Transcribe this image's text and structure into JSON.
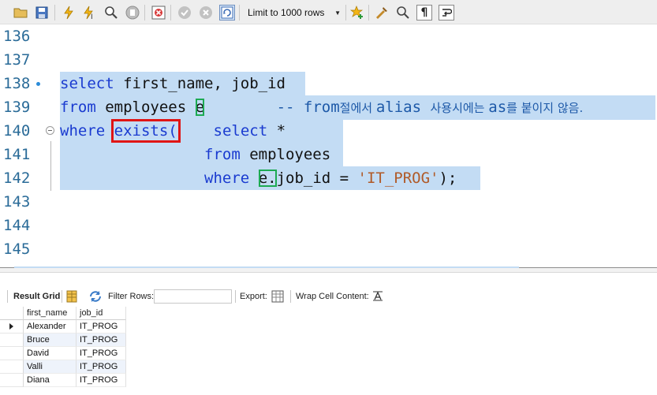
{
  "toolbar": {
    "buttons": [
      {
        "name": "open-folder-icon",
        "color": "#d8a93a"
      },
      {
        "name": "save-icon",
        "color": "#3a6bb5"
      },
      {
        "name": "execute-icon",
        "color": "#f0b20a"
      },
      {
        "name": "execute-statement-icon",
        "color": "#f0b20a"
      },
      {
        "name": "explain-icon",
        "color": "#555555"
      },
      {
        "name": "stop-icon",
        "color": "#9a9a9a"
      },
      {
        "name": "toggle-error-icon",
        "color": "#d23a3a"
      },
      {
        "name": "commit-icon",
        "color": "#9a9a9a"
      },
      {
        "name": "rollback-icon",
        "color": "#9a9a9a"
      },
      {
        "name": "autocommit-icon",
        "color": "#3a6bb5"
      }
    ],
    "limit_label": "Limit to 1000 rows",
    "right_buttons": [
      {
        "name": "add-snippet-icon",
        "color": "#f0b20a"
      },
      {
        "name": "beautify-icon",
        "color": "#c48a2a"
      },
      {
        "name": "find-icon",
        "color": "#444444"
      },
      {
        "name": "invisible-chars-icon",
        "color": "#222222"
      },
      {
        "name": "wrap-icon",
        "color": "#222222"
      }
    ]
  },
  "editor": {
    "lines": [
      {
        "num": "136"
      },
      {
        "num": "137"
      },
      {
        "num": "138"
      },
      {
        "num": "139"
      },
      {
        "num": "140"
      },
      {
        "num": "141"
      },
      {
        "num": "142"
      },
      {
        "num": "143"
      },
      {
        "num": "144"
      },
      {
        "num": "145"
      }
    ],
    "code": {
      "l138": {
        "kw1": "select",
        "rest": " first_name, job_id"
      },
      "l139": {
        "kw1": "from",
        "mid": " employees ",
        "alias": "e",
        "comment1": "-- from",
        "comment_ko1": "절에서 ",
        "comment2": "alias ",
        "comment_ko2": "사용시에는 ",
        "comment3": "as",
        "comment_ko3": "를 붙이지 않음."
      },
      "l140": {
        "kw1": "where",
        "exists": "exists(",
        "kw2": "select",
        "rest": " *"
      },
      "l141": {
        "kw1": "from",
        "rest": " employees"
      },
      "l142": {
        "kw1": "where",
        "alias": "e.",
        "rest": "job_id = ",
        "str": "'IT_PROG'",
        "end": ");"
      }
    }
  },
  "result_toolbar": {
    "result_grid_label": "Result Grid",
    "filter_label": "Filter Rows:",
    "filter_value": "",
    "export_label": "Export:",
    "wrap_label": "Wrap Cell Content:"
  },
  "grid": {
    "columns": [
      "first_name",
      "job_id"
    ],
    "rows": [
      [
        "Alexander",
        "IT_PROG"
      ],
      [
        "Bruce",
        "IT_PROG"
      ],
      [
        "David",
        "IT_PROG"
      ],
      [
        "Valli",
        "IT_PROG"
      ],
      [
        "Diana",
        "IT_PROG"
      ]
    ]
  }
}
